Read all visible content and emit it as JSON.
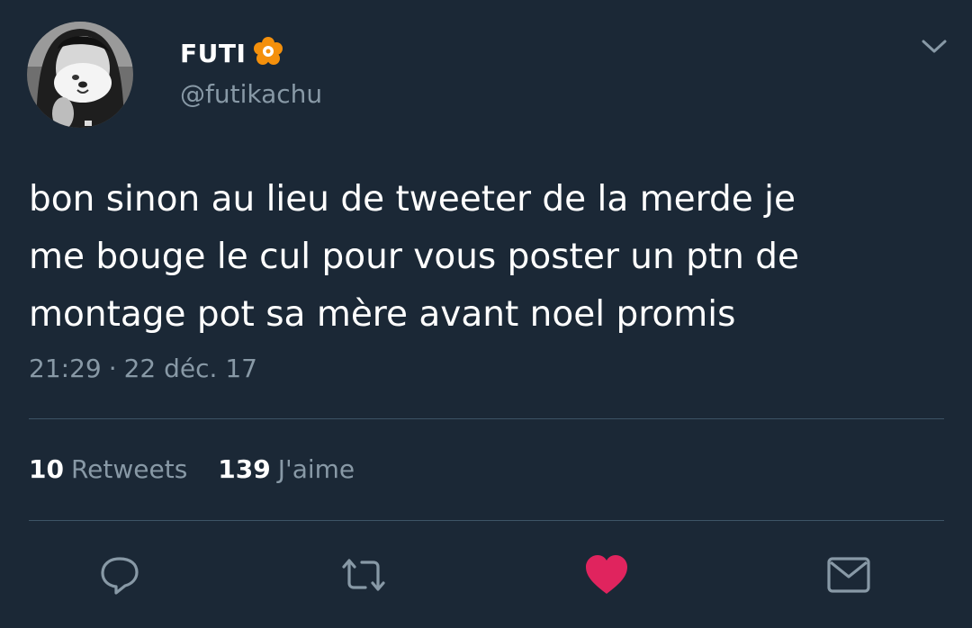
{
  "author": {
    "display_name": "FUTI",
    "handle": "@futikachu",
    "badge_icon": "hibiscus-flower-icon"
  },
  "tweet": {
    "text_lines": [
      "bon sinon au lieu de tweeter de la merde je",
      "me bouge le cul pour vous poster un ptn de",
      "montage pot sa mère avant noel promis"
    ],
    "time": "21:29",
    "separator": "·",
    "date": "22 déc. 17"
  },
  "stats": {
    "retweets_count": "10",
    "retweets_label": "Retweets",
    "likes_count": "139",
    "likes_label": "J'aime"
  },
  "actions": [
    "reply-icon",
    "retweet-icon",
    "heart-icon",
    "envelope-icon"
  ],
  "colors": {
    "background": "#1b2836",
    "text": "#ffffff",
    "muted": "#8899a6",
    "divider": "#3d5466",
    "like": "#e0245e",
    "badge": "#f4900c"
  }
}
